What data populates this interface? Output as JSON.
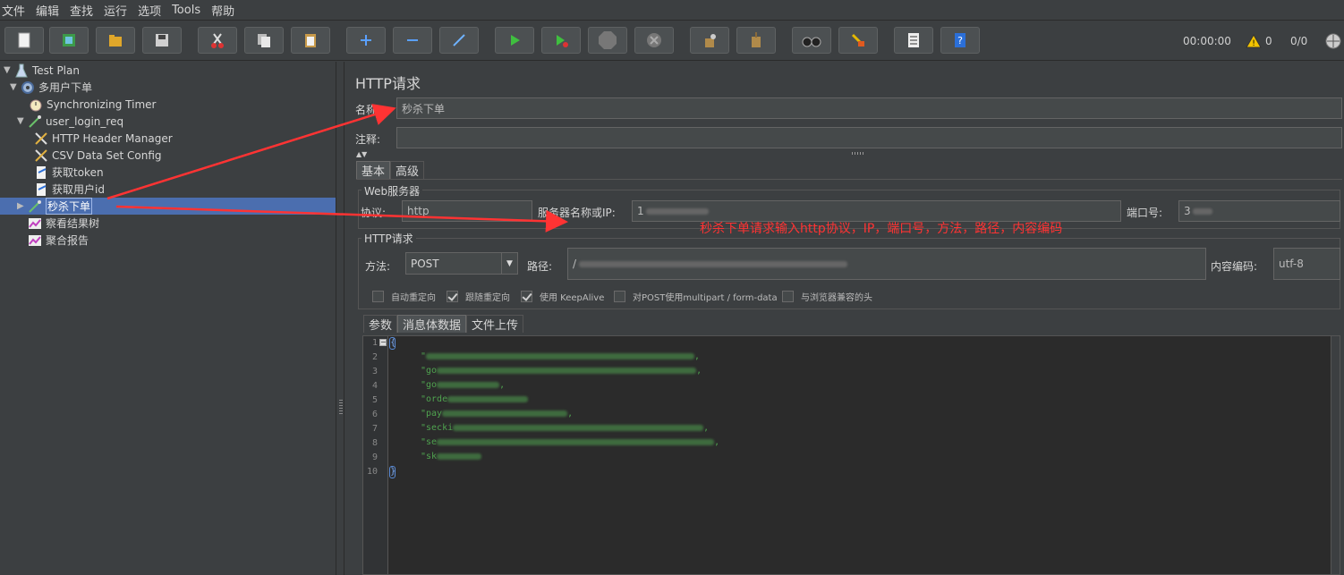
{
  "menu": [
    "文件",
    "编辑",
    "查找",
    "运行",
    "选项",
    "Tools",
    "帮助"
  ],
  "toolbar": {
    "timer": "00:00:00",
    "warning_count": "0",
    "thread_ratio": "0/0"
  },
  "tree": {
    "items": [
      {
        "label": "Test Plan",
        "icon": "test-plan-icon"
      },
      {
        "label": "多用户下单",
        "icon": "thread-group-icon"
      },
      {
        "label": "Synchronizing Timer",
        "icon": "timer-icon"
      },
      {
        "label": "user_login_req",
        "icon": "sampler-icon"
      },
      {
        "label": "HTTP Header Manager",
        "icon": "config-icon"
      },
      {
        "label": "CSV Data Set Config",
        "icon": "config-icon"
      },
      {
        "label": "获取token",
        "icon": "extractor-icon"
      },
      {
        "label": "获取用户id",
        "icon": "extractor-icon"
      },
      {
        "label": "秒杀下单",
        "icon": "sampler-icon"
      },
      {
        "label": "察看结果树",
        "icon": "listener-icon"
      },
      {
        "label": "聚合报告",
        "icon": "listener-icon"
      }
    ]
  },
  "panel": {
    "title": "HTTP请求",
    "name_label": "名称:",
    "name_value": "秒杀下单",
    "comment_label": "注释:",
    "tabs": [
      "基本",
      "高级"
    ],
    "web_server_title": "Web服务器",
    "protocol_label": "协议:",
    "protocol_value": "http",
    "server_label": "服务器名称或IP:",
    "server_value": "1",
    "port_label": "端口号:",
    "port_value": "3",
    "http_request_title": "HTTP请求",
    "method_label": "方法:",
    "method_value": "POST",
    "path_label": "路径:",
    "path_value": "/",
    "encoding_label": "内容编码:",
    "encoding_value": "utf-8",
    "checkboxes": [
      {
        "label": "自动重定向",
        "checked": false
      },
      {
        "label": "跟随重定向",
        "checked": true
      },
      {
        "label": "使用 KeepAlive",
        "checked": true
      },
      {
        "label": "对POST使用multipart / form-data",
        "checked": false
      },
      {
        "label": "与浏览器兼容的头",
        "checked": false
      }
    ],
    "body_tabs": [
      "参数",
      "消息体数据",
      "文件上传"
    ],
    "line_numbers": [
      "1",
      "2",
      "3",
      "4",
      "5",
      "6",
      "7",
      "8",
      "9",
      "10"
    ],
    "code_lines": [
      "{",
      "\"",
      "\"go",
      "\"go",
      "\"orde",
      "\"pay",
      "\"secki",
      "\"se",
      "\"sk",
      "}"
    ]
  },
  "annotation": "秒杀下单请求输入http协议，IP，端口号，方法，路径，内容编码"
}
